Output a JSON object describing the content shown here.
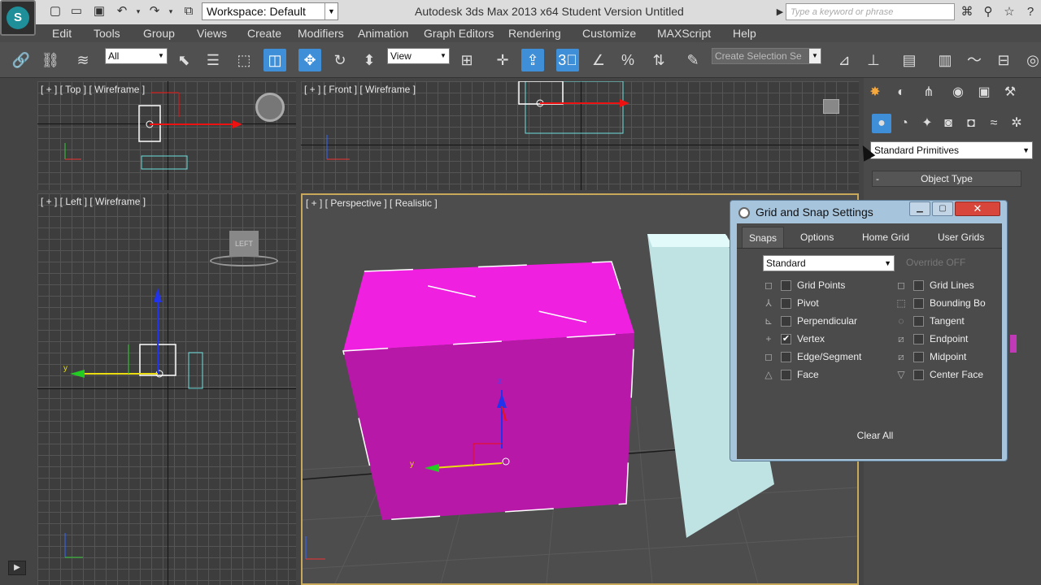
{
  "app": {
    "workspace_label": "Workspace: Default",
    "window_title": "Autodesk 3ds Max  2013 x64    Student Version    Untitled",
    "search_placeholder": "Type a keyword or phrase"
  },
  "menu": [
    "Edit",
    "Tools",
    "Group",
    "Views",
    "Create",
    "Modifiers",
    "Animation",
    "Graph Editors",
    "Rendering",
    "Customize",
    "MAXScript",
    "Help"
  ],
  "toolbar": {
    "selection_filter": "All",
    "reference_coord": "View",
    "named_selection_placeholder": "Create Selection Se"
  },
  "viewports": {
    "top": "[ + ] [ Top ] [ Wireframe ]",
    "front": "[ + ] [ Front ] [ Wireframe ]",
    "left": "[ + ] [ Left ] [ Wireframe ]",
    "perspective": "[ + ] [ Perspective ] [ Realistic ]",
    "viewcube_left_label": "LEFT"
  },
  "command_panel": {
    "category": "Standard Primitives",
    "rollout_title": "Object Type",
    "rollout_toggle": "-"
  },
  "dialog": {
    "title": "Grid and Snap Settings",
    "tabs": [
      "Snaps",
      "Options",
      "Home Grid",
      "User Grids"
    ],
    "active_tab": "Snaps",
    "snap_type": "Standard",
    "override": "Override OFF",
    "left_column": [
      {
        "label": "Grid Points",
        "checked": false
      },
      {
        "label": "Pivot",
        "checked": false
      },
      {
        "label": "Perpendicular",
        "checked": false
      },
      {
        "label": "Vertex",
        "checked": true
      },
      {
        "label": "Edge/Segment",
        "checked": false
      },
      {
        "label": "Face",
        "checked": false
      }
    ],
    "right_column": [
      {
        "label": "Grid Lines",
        "checked": false
      },
      {
        "label": "Bounding Bo",
        "checked": false
      },
      {
        "label": "Tangent",
        "checked": false
      },
      {
        "label": "Endpoint",
        "checked": false
      },
      {
        "label": "Midpoint",
        "checked": false
      },
      {
        "label": "Center Face",
        "checked": false
      }
    ],
    "clear_all": "Clear All"
  },
  "colors": {
    "box_magenta": "#e020d0",
    "box_cyan": "#d6f4f4",
    "active_tool": "#3f8fd8",
    "dialog_frame": "#a7c4dd",
    "close_button": "#d8453a"
  }
}
